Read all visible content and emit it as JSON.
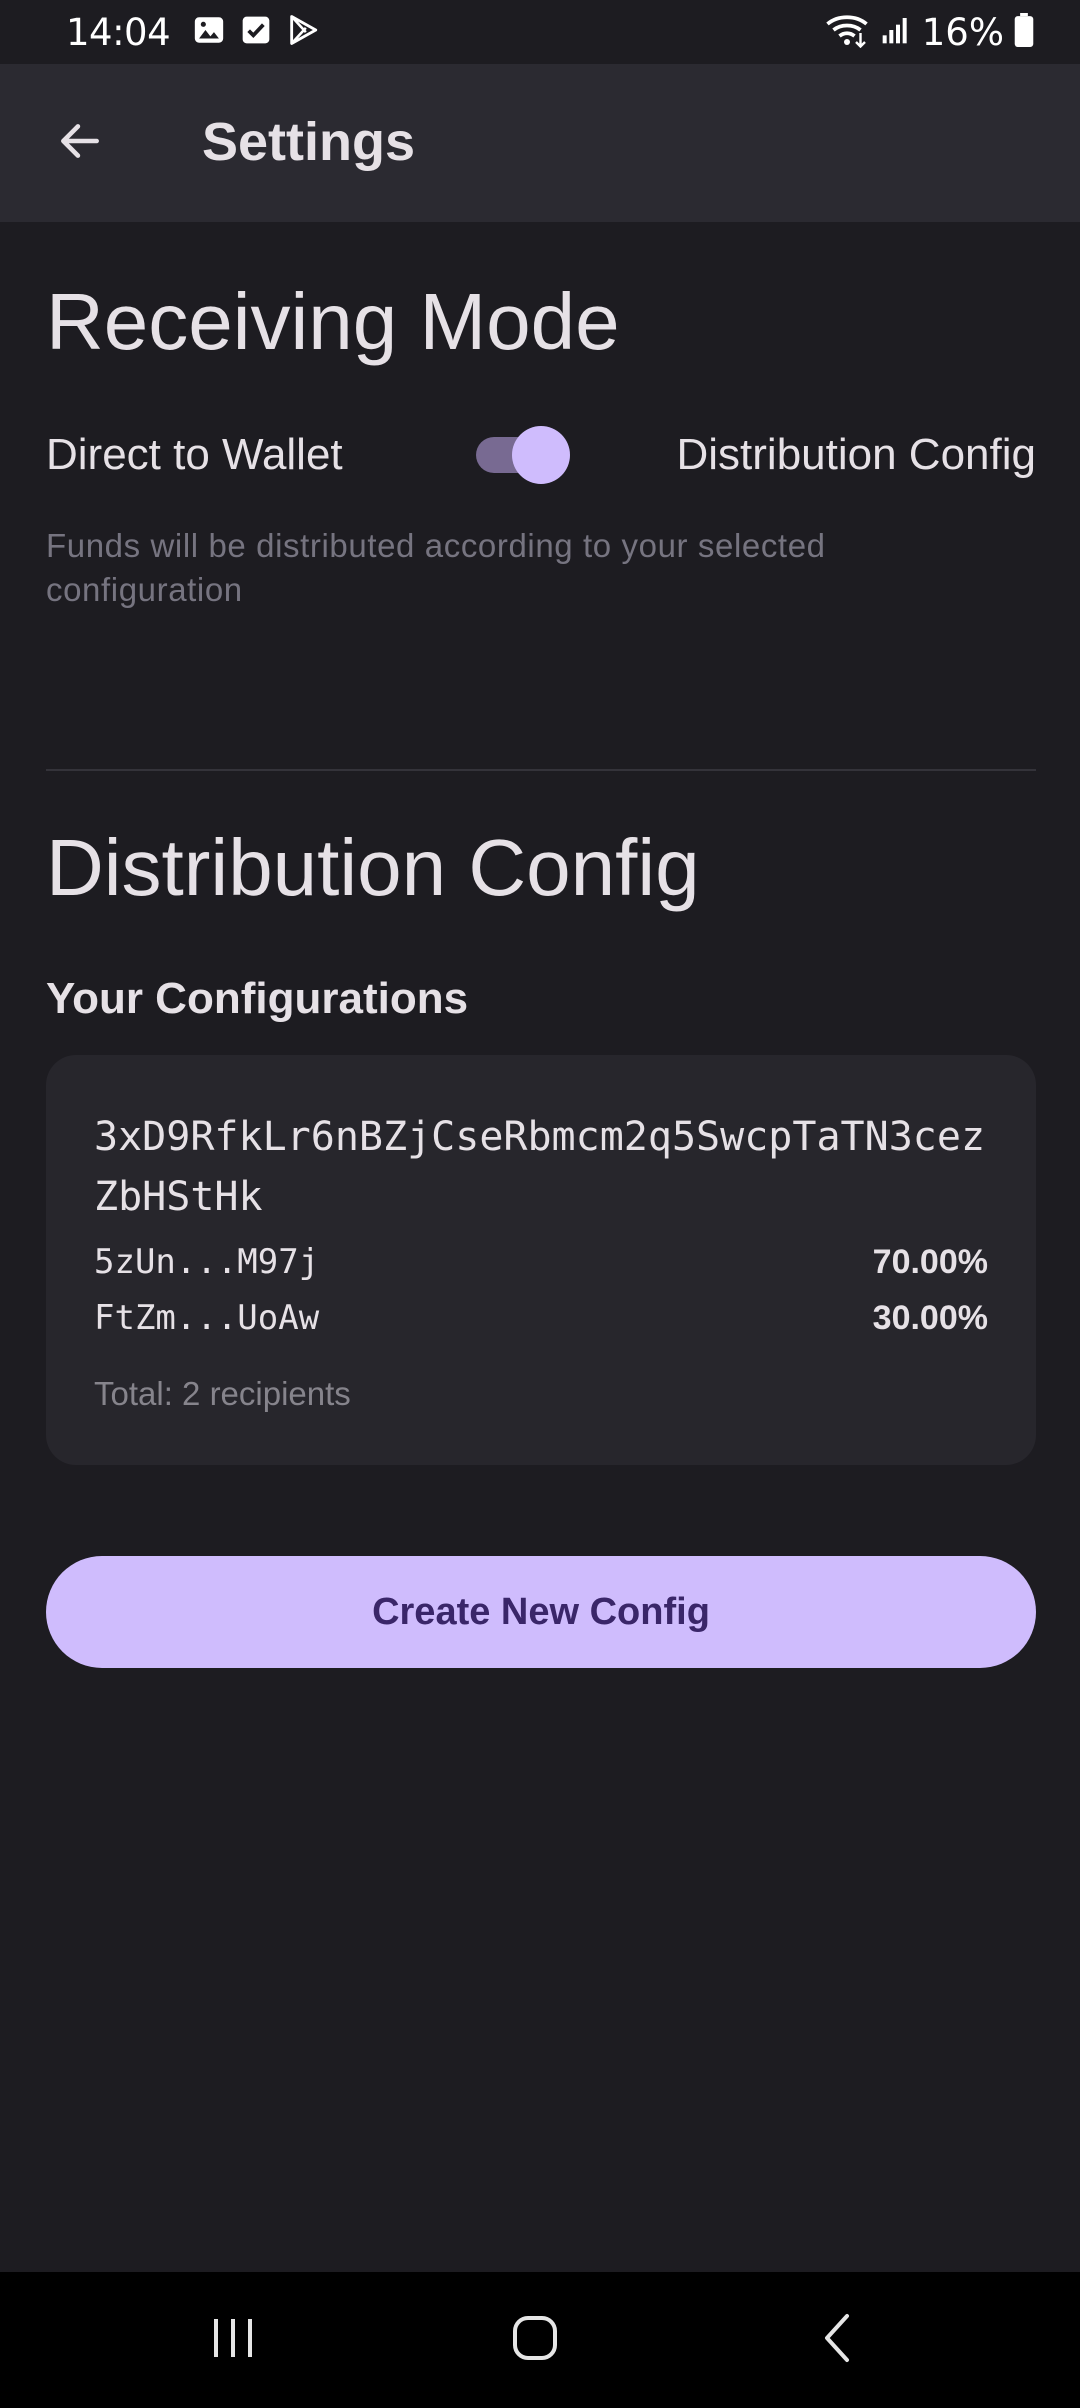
{
  "status_bar": {
    "time": "14:04",
    "battery": "16%",
    "left_icons": [
      "image-icon",
      "check-square-icon",
      "play-store-icon"
    ],
    "right_icons": [
      "wifi-icon",
      "signal-icon",
      "battery-icon"
    ]
  },
  "app_bar": {
    "title": "Settings",
    "back_icon": "arrow-left-icon"
  },
  "receiving_mode": {
    "title": "Receiving Mode",
    "left_option": "Direct to Wallet",
    "right_option": "Distribution Config",
    "toggle_on": true,
    "helper": "Funds will be distributed according to your selected configuration"
  },
  "distribution_config": {
    "title": "Distribution Config",
    "subheading": "Your Configurations",
    "configs": [
      {
        "id": "3xD9RfkLr6nBZjCseRbmcm2q5SwcpTaTN3cezZbHStHk",
        "recipients": [
          {
            "address": "5zUn...M97j",
            "share": "70.00%"
          },
          {
            "address": "FtZm...UoAw",
            "share": "30.00%"
          }
        ],
        "total": "Total: 2 recipients"
      }
    ],
    "create_button": "Create New Config"
  },
  "colors": {
    "background": "#1d1c21",
    "app_bar": "#2b2a31",
    "accent": "#cfbcfd",
    "card": "#27262c",
    "button_text": "#3a2669"
  },
  "nav_bar": {
    "buttons": [
      "recents-icon",
      "home-icon",
      "back-icon"
    ]
  }
}
